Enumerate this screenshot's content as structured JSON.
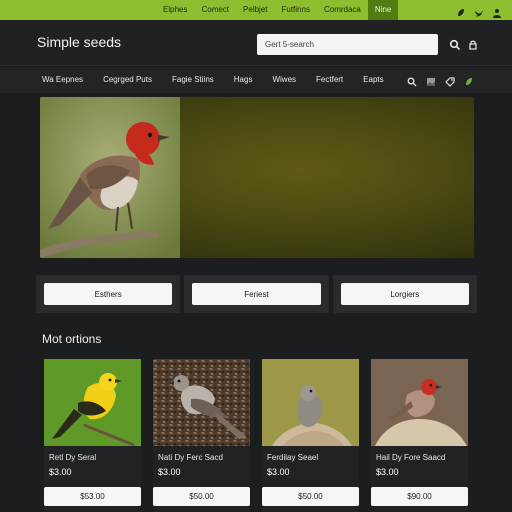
{
  "topbar": {
    "links": [
      "Elphes",
      "Comect",
      "Pelbjet",
      "Futfinns",
      "Comrdaca",
      "Nine"
    ],
    "active_index": 5,
    "social_icons": [
      "leaf-icon",
      "bird-icon",
      "person-icon"
    ]
  },
  "header": {
    "brand": "Simple seeds",
    "search_placeholder": "Gert 5-search",
    "icons": [
      "search-icon",
      "lock-icon"
    ]
  },
  "nav": {
    "items": [
      "Wa Eepnes",
      "Cegrged Puts",
      "Fagie Stiins",
      "Hags",
      "Wiwes",
      "Fectfert",
      "Eapts"
    ],
    "tools": [
      "search-icon",
      "image-icon",
      "tag-icon",
      "leaf-icon"
    ]
  },
  "categories": [
    "Esthers",
    "Feriest",
    "Lorgiers"
  ],
  "section": {
    "title": "Mot ortions"
  },
  "products": [
    {
      "name": "Retl Dy Seral",
      "price": "$3.00",
      "cta": "$53.00"
    },
    {
      "name": "Nati Dy Ferc Sacd",
      "price": "$3.00",
      "cta": "$50.00"
    },
    {
      "name": "Ferdilay Seael",
      "price": "$3.00",
      "cta": "$50.00"
    },
    {
      "name": "Hail Dy Fore Saacd",
      "price": "$3.00",
      "cta": "$90.00"
    }
  ],
  "colors": {
    "accent": "#8cbf2f",
    "accent_dark": "#4f7d12",
    "bg": "#1c1d1e"
  }
}
